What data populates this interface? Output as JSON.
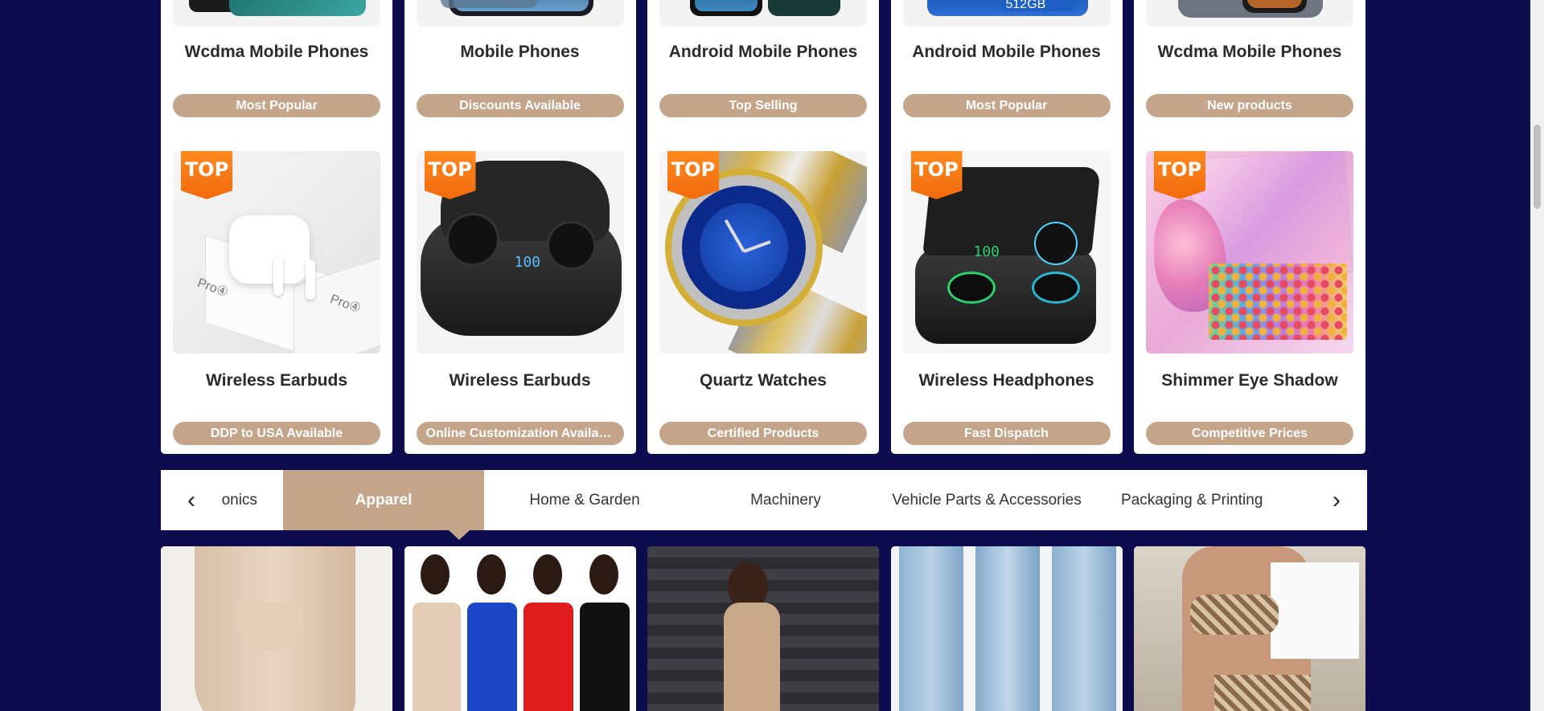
{
  "row1": [
    {
      "title": "Wcdma Mobile Phones",
      "tag": "Most Popular"
    },
    {
      "title": "Mobile Phones",
      "tag": "Discounts Available"
    },
    {
      "title": "Android Mobile Phones",
      "tag": "Top Selling"
    },
    {
      "title": "Android Mobile Phones",
      "tag": "Most Popular",
      "img_text": "512GB"
    },
    {
      "title": "Wcdma Mobile Phones",
      "tag": "New products"
    }
  ],
  "row2": [
    {
      "badge": "TOP",
      "title": "Wireless Earbuds",
      "tag": "DDP to USA Available",
      "img_text": [
        "Pro④",
        "Pro④"
      ]
    },
    {
      "badge": "TOP",
      "title": "Wireless Earbuds",
      "tag": "Online Customization Available",
      "img_text": "100"
    },
    {
      "badge": "TOP",
      "title": "Quartz Watches",
      "tag": "Certified Products"
    },
    {
      "badge": "TOP",
      "title": "Wireless Headphones",
      "tag": "Fast Dispatch",
      "img_text": "100"
    },
    {
      "badge": "TOP",
      "title": "Shimmer Eye Shadow",
      "tag": "Competitive Prices"
    }
  ],
  "tabs": {
    "items": [
      "Consumer Electronics",
      "Apparel",
      "Home & Garden",
      "Machinery",
      "Vehicle Parts & Accessories",
      "Packaging & Printing"
    ],
    "active_index": 1
  },
  "colors": {
    "page_bg": "#0c0c4f",
    "accent": "#c4a58a",
    "badge": "#f57a13"
  }
}
